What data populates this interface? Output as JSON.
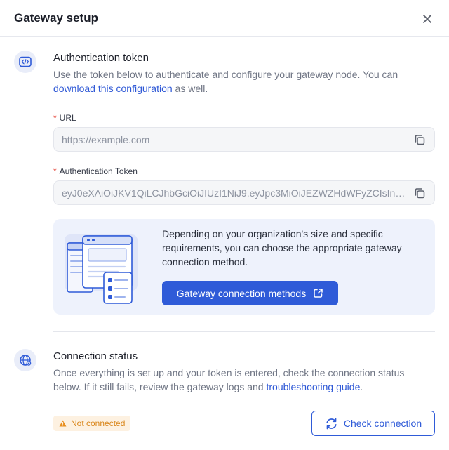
{
  "dialog": {
    "title": "Gateway setup",
    "close_icon": "close-icon"
  },
  "auth_section": {
    "icon": "code-icon",
    "title": "Authentication token",
    "desc_prefix": "Use the token below to authenticate and configure your gateway node. You can ",
    "desc_link": "download this configuration",
    "desc_suffix": " as well.",
    "url_label": "URL",
    "url_value": "https://example.com",
    "token_label": "Authentication Token",
    "token_value": "eyJ0eXAiOiJKV1QiLCJhbGciOiJIUzI1NiJ9.eyJpc3MiOiJEZWZHdWFyZCIsInN...",
    "copy_icon": "copy-icon"
  },
  "banner": {
    "text": "Depending on your organization's size and specific requirements, you can choose the appropriate gateway connection method.",
    "button_label": "Gateway connection methods",
    "button_icon": "external-link-icon"
  },
  "status_section": {
    "icon": "globe-icon",
    "title": "Connection status",
    "desc_prefix": "Once everything is set up and your token is entered, check the connection status below. If it still fails, review the gateway logs and ",
    "desc_link": "troubleshooting guide",
    "desc_suffix": ".",
    "badge_label": "Not connected",
    "badge_icon": "warning-icon",
    "check_label": "Check connection",
    "check_icon": "refresh-icon"
  },
  "colors": {
    "accent": "#2f5bd8",
    "link": "#2e58d6",
    "required": "#e5483d",
    "warning_text": "#d9861b",
    "warning_bg": "#fdf1e1",
    "banner_bg": "#eef2fc"
  }
}
